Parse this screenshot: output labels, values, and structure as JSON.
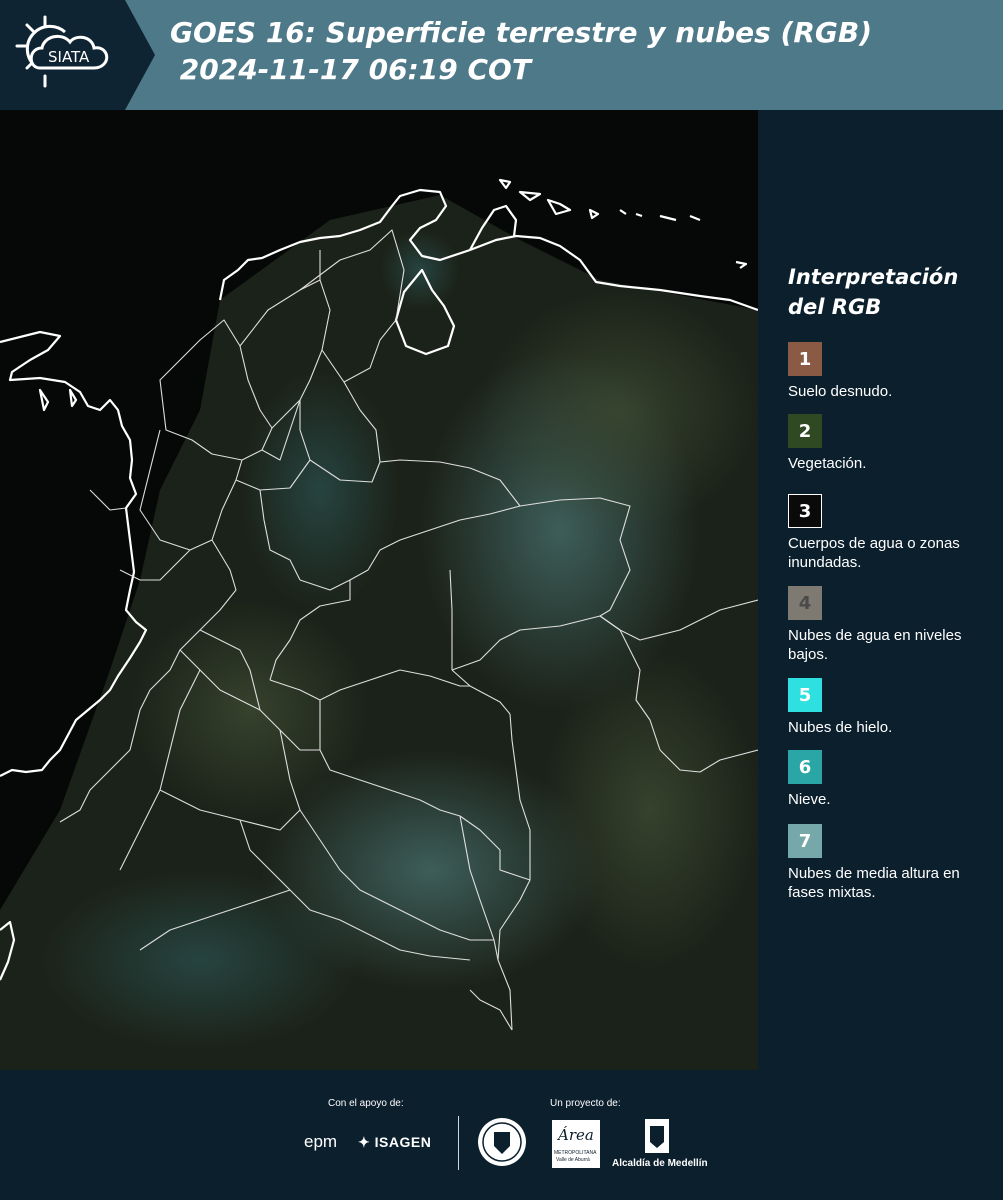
{
  "header": {
    "logo_text": "SIATA",
    "title_line1": "GOES 16: Superficie terrestre y nubes (RGB)",
    "title_line2": " 2024-11-17 06:19 COT"
  },
  "legend": {
    "title": "Interpretación del RGB",
    "items": [
      {
        "num": "1",
        "label": "Suelo desnudo.",
        "color": "#8a5a45",
        "text_color": "#ffffff"
      },
      {
        "num": "2",
        "label": "Vegetación.",
        "color": "#2f4a23",
        "text_color": "#ffffff"
      },
      {
        "num": "3",
        "label": "Cuerpos de agua o zonas inundadas.",
        "color": "#0a0a0a",
        "text_color": "#ffffff"
      },
      {
        "num": "4",
        "label": "Nubes de agua en niveles bajos.",
        "color": "#7e7a72",
        "text_color": "#4a4a4a"
      },
      {
        "num": "5",
        "label": "Nubes de hielo.",
        "color": "#2ee0e0",
        "text_color": "#ffffff"
      },
      {
        "num": "6",
        "label": "Nieve.",
        "color": "#2aa6a6",
        "text_color": "#ffffff"
      },
      {
        "num": "7",
        "label": "Nubes de media altura en fases mixtas.",
        "color": "#76a8aa",
        "text_color": "#ffffff"
      }
    ]
  },
  "footer": {
    "support_label": "Con el apoyo de:",
    "project_label": "Un proyecto de:",
    "sponsor1": "epm",
    "sponsor2": "ISAGEN",
    "area_logo_text": "Área",
    "area_sub1": "METROPOLITANA",
    "area_sub2": "Valle de Aburrá",
    "city_label": "Alcaldía de Medellín"
  }
}
